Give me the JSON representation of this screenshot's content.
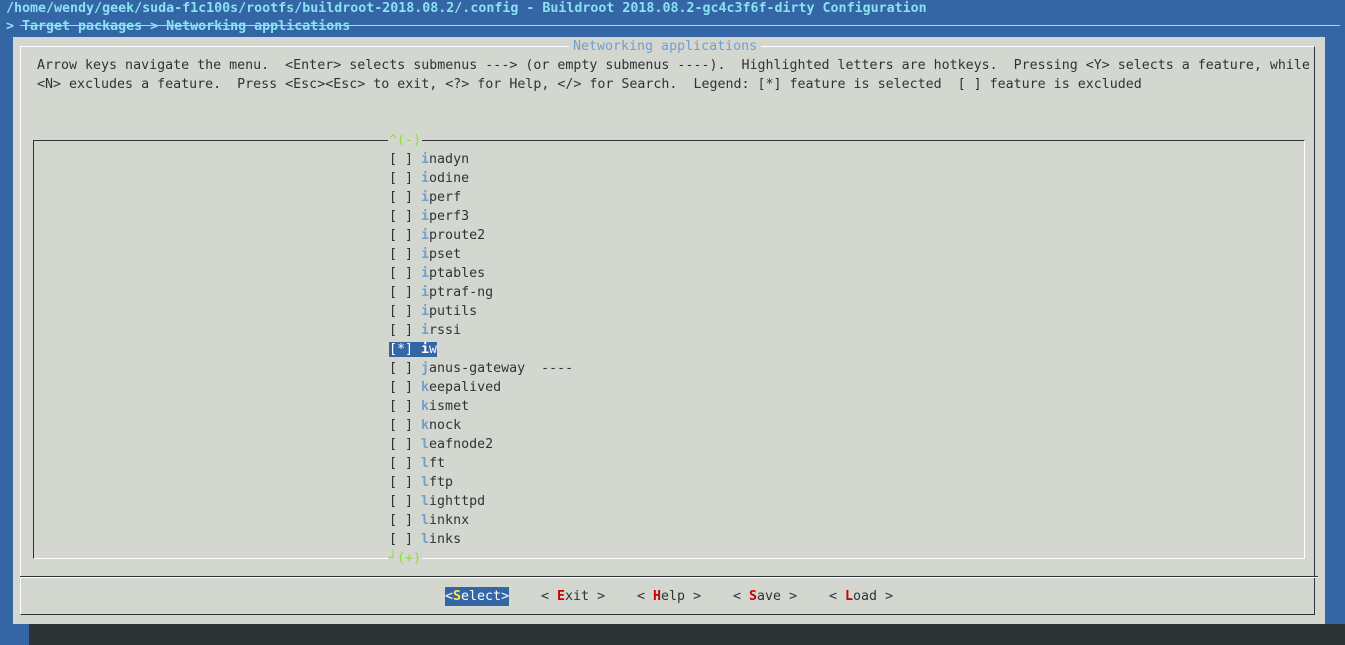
{
  "window_title": "/home/wendy/geek/suda-f1c100s/rootfs/buildroot-2018.08.2/.config - Buildroot 2018.08.2-gc4c3f6f-dirty Configuration",
  "breadcrumb": "> Target packages > Networking applications",
  "dialog": {
    "title": "Networking applications",
    "help_line1": "Arrow keys navigate the menu.  <Enter> selects submenus ---> (or empty submenus ----).  Highlighted letters are hotkeys.  Pressing <Y> selects a feature, while",
    "help_line2": "<N> excludes a feature.  Press <Esc><Esc> to exit, <?> for Help, </> for Search.  Legend: [*] feature is selected  [ ] feature is excluded",
    "scroll_up": "^(-)",
    "scroll_down": "(+)",
    "items": [
      {
        "box": "[ ]",
        "hot": "i",
        "rest": "nadyn",
        "suffix": "",
        "selected": false
      },
      {
        "box": "[ ]",
        "hot": "i",
        "rest": "odine",
        "suffix": "",
        "selected": false
      },
      {
        "box": "[ ]",
        "hot": "i",
        "rest": "perf",
        "suffix": "",
        "selected": false
      },
      {
        "box": "[ ]",
        "hot": "i",
        "rest": "perf3",
        "suffix": "",
        "selected": false
      },
      {
        "box": "[ ]",
        "hot": "i",
        "rest": "proute2",
        "suffix": "",
        "selected": false
      },
      {
        "box": "[ ]",
        "hot": "i",
        "rest": "pset",
        "suffix": "",
        "selected": false
      },
      {
        "box": "[ ]",
        "hot": "i",
        "rest": "ptables",
        "suffix": "",
        "selected": false
      },
      {
        "box": "[ ]",
        "hot": "i",
        "rest": "ptraf-ng",
        "suffix": "",
        "selected": false
      },
      {
        "box": "[ ]",
        "hot": "i",
        "rest": "putils",
        "suffix": "",
        "selected": false
      },
      {
        "box": "[ ]",
        "hot": "i",
        "rest": "rssi",
        "suffix": "",
        "selected": false
      },
      {
        "box": "[*]",
        "hot": "i",
        "rest": "w",
        "suffix": "",
        "selected": true
      },
      {
        "box": "[ ]",
        "hot": "j",
        "rest": "anus-gateway",
        "suffix": "  ----",
        "selected": false
      },
      {
        "box": "[ ]",
        "hot": "k",
        "rest": "eepalived",
        "suffix": "",
        "selected": false
      },
      {
        "box": "[ ]",
        "hot": "k",
        "rest": "ismet",
        "suffix": "",
        "selected": false
      },
      {
        "box": "[ ]",
        "hot": "k",
        "rest": "nock",
        "suffix": "",
        "selected": false
      },
      {
        "box": "[ ]",
        "hot": "l",
        "rest": "eafnode2",
        "suffix": "",
        "selected": false
      },
      {
        "box": "[ ]",
        "hot": "l",
        "rest": "ft",
        "suffix": "",
        "selected": false
      },
      {
        "box": "[ ]",
        "hot": "l",
        "rest": "ftp",
        "suffix": "",
        "selected": false
      },
      {
        "box": "[ ]",
        "hot": "l",
        "rest": "ighttpd",
        "suffix": "",
        "selected": false
      },
      {
        "box": "[ ]",
        "hot": "l",
        "rest": "inknx",
        "suffix": "",
        "selected": false
      },
      {
        "box": "[ ]",
        "hot": "l",
        "rest": "inks",
        "suffix": "",
        "selected": false
      }
    ],
    "buttons": [
      {
        "name": "select-button",
        "pre": "<",
        "hot": "S",
        "rest": "elect",
        "post": ">",
        "active": true
      },
      {
        "name": "exit-button",
        "pre": "< ",
        "hot": "E",
        "rest": "xit",
        "post": " >",
        "active": false
      },
      {
        "name": "help-button",
        "pre": "< ",
        "hot": "H",
        "rest": "elp",
        "post": " >",
        "active": false
      },
      {
        "name": "save-button",
        "pre": "< ",
        "hot": "S",
        "rest": "ave",
        "post": " >",
        "active": false
      },
      {
        "name": "load-button",
        "pre": "< ",
        "hot": "L",
        "rest": "oad",
        "post": " >",
        "active": false
      }
    ]
  }
}
